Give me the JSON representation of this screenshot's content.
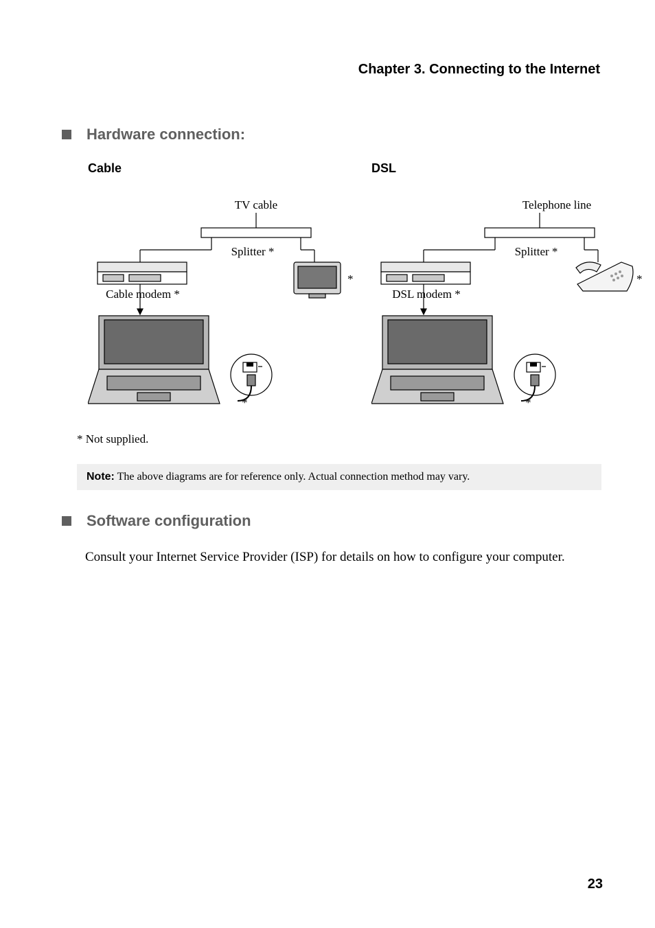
{
  "chapter": "Chapter 3. Connecting to the Internet",
  "section1": "Hardware connection:",
  "diagram1": {
    "title": "Cable",
    "line_in": "TV cable",
    "splitter": "Splitter *",
    "modem": "Cable modem *",
    "asterisk1": "*",
    "asterisk2": "*"
  },
  "diagram2": {
    "title": "DSL",
    "line_in": "Telephone line",
    "splitter": "Splitter *",
    "modem": "DSL modem *",
    "asterisk1": "*",
    "asterisk2": "*"
  },
  "footnote": "* Not supplied.",
  "note_label": "Note:",
  "note_text": " The above diagrams are for reference only. Actual connection method may vary.",
  "section2": "Software configuration",
  "body": "Consult your Internet Service Provider (ISP) for details on how to configure your computer.",
  "page_number": "23"
}
